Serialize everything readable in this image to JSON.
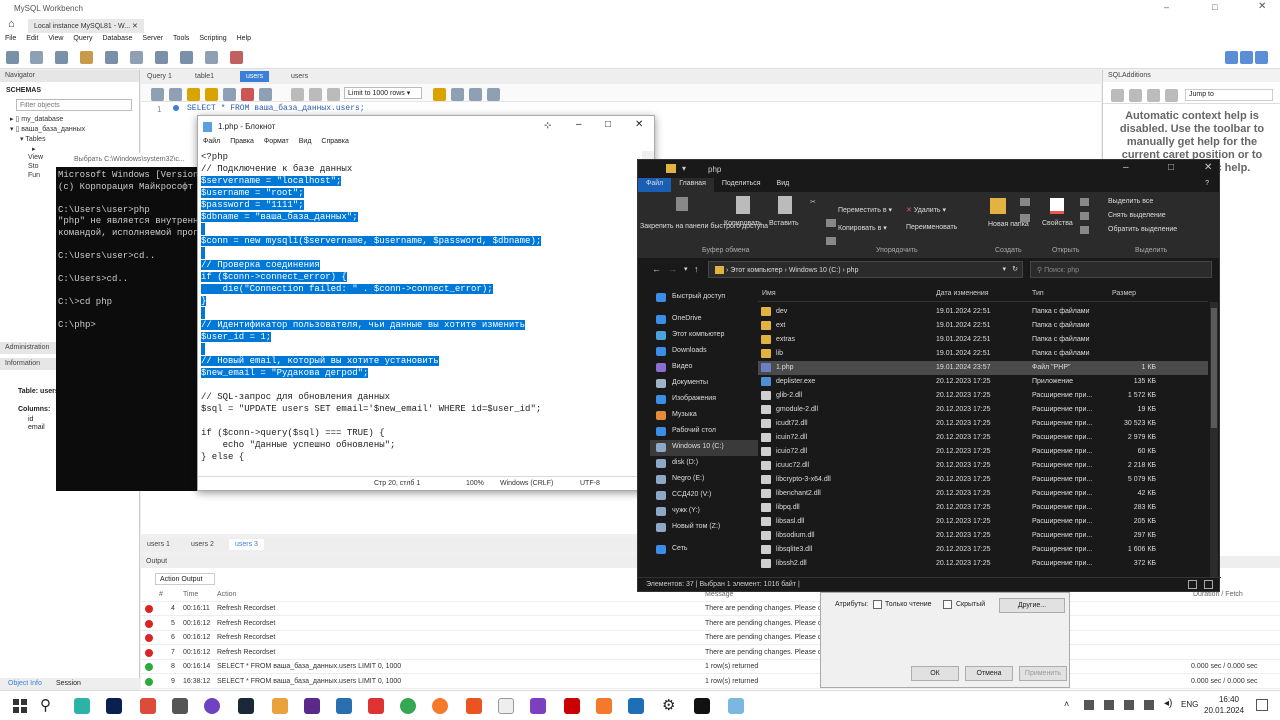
{
  "workbench": {
    "title": "MySQL Workbench",
    "home_tab": "Local instance MySQL81 - W...",
    "menu": [
      "File",
      "Edit",
      "View",
      "Query",
      "Database",
      "Server",
      "Tools",
      "Scripting",
      "Help"
    ],
    "navigator": {
      "label": "Navigator",
      "schemas": "SCHEMAS",
      "filter_placeholder": "Filter objects",
      "tree": [
        "my_database",
        "ваша_база_данных",
        "Tables",
        "View",
        "Sto",
        "Fun"
      ]
    },
    "admin_tabs": [
      "Administration",
      "Information"
    ],
    "info": {
      "table_label": "Table: users",
      "columns_label": "Columns:",
      "cols": [
        "id",
        "email"
      ]
    },
    "query_tabs": [
      "Query 1",
      "table1",
      "users",
      "users"
    ],
    "limit": "Limit to 1000 rows",
    "sql_line_no": "1",
    "sql": "SELECT * FROM ваша_база_данных.users;",
    "sqladd": {
      "title": "SQLAdditions",
      "jump": "Jump to",
      "help": "Automatic context help is disabled. Use the toolbar to manually get help for the current caret position or to toggle automatic help."
    },
    "result_tabs": [
      "users 1",
      "users 2",
      "users 3"
    ],
    "output": {
      "label": "Output",
      "mode": "Action Output",
      "headers": [
        "#",
        "Time",
        "Action",
        "Message",
        "Duration / Fetch"
      ],
      "rows": [
        {
          "n": "4",
          "time": "00:16:11",
          "action": "Refresh Recordset",
          "msg": "There are pending changes. Please c",
          "dur": "",
          "status": "err"
        },
        {
          "n": "5",
          "time": "00:16:12",
          "action": "Refresh Recordset",
          "msg": "There are pending changes. Please c",
          "dur": "",
          "status": "err"
        },
        {
          "n": "6",
          "time": "00:16:12",
          "action": "Refresh Recordset",
          "msg": "There are pending changes. Please c",
          "dur": "",
          "status": "err"
        },
        {
          "n": "7",
          "time": "00:16:12",
          "action": "Refresh Recordset",
          "msg": "There are pending changes. Please c",
          "dur": "",
          "status": "err"
        },
        {
          "n": "8",
          "time": "00:16:14",
          "action": "SELECT * FROM ваша_база_данных.users LIMIT 0, 1000",
          "msg": "1 row(s) returned",
          "dur": "0.000 sec / 0.000 sec",
          "status": "ok"
        },
        {
          "n": "9",
          "time": "16:38:12",
          "action": "SELECT * FROM ваша_база_данных.users LIMIT 0, 1000",
          "msg": "1 row(s) returned",
          "dur": "0.000 sec / 0.000 sec",
          "status": "ok"
        }
      ]
    },
    "bottom_tabs": [
      "Object Info",
      "Session"
    ]
  },
  "cmd": {
    "title": "Выбрать C:\\Windows\\system32\\c...",
    "text": "Microsoft Windows [Version\n(c) Корпорация Майкрософт\n\nC:\\Users\\user>php\n\"php\" не является внутренн\nкомандой, исполняемой прог\n\nC:\\Users\\user>cd..\n\nC:\\Users>cd..\n\nC:\\>cd php\n\nC:\\php>"
  },
  "notepad": {
    "title": "1.php - Блокнот",
    "menu": [
      "Файл",
      "Правка",
      "Формат",
      "Вид",
      "Справка"
    ],
    "lines": [
      {
        "t": "<?php",
        "h": false
      },
      {
        "t": "// Подключение к базе данных",
        "h": false
      },
      {
        "t": "$servername = \"localhost\";",
        "h": true
      },
      {
        "t": "$username = \"root\";",
        "h": true
      },
      {
        "t": "$password = \"1111\";",
        "h": true
      },
      {
        "t": "$dbname = \"ваша_база_данных\";",
        "h": true
      },
      {
        "t": "",
        "h": true
      },
      {
        "t": "$conn = new mysqli($servername, $username, $password, $dbname);",
        "h": true
      },
      {
        "t": "",
        "h": true
      },
      {
        "t": "// Проверка соединения",
        "h": true
      },
      {
        "t": "if ($conn->connect_error) {",
        "h": true
      },
      {
        "t": "    die(\"Connection failed: \" . $conn->connect_error);",
        "h": true
      },
      {
        "t": "}",
        "h": true
      },
      {
        "t": "",
        "h": true
      },
      {
        "t": "// Идентификатор пользователя, чьи данные вы хотите изменить",
        "h": true
      },
      {
        "t": "$user_id = 1;",
        "h": true
      },
      {
        "t": "",
        "h": true
      },
      {
        "t": "// Новый email, который вы хотите установить",
        "h": true
      },
      {
        "t": "$new_email = \"Рудакова дегроd\";",
        "h": true
      },
      {
        "t": "",
        "h": false
      },
      {
        "t": "// SQL-запрос для обновления данных",
        "h": false
      },
      {
        "t": "$sql = \"UPDATE users SET email='$new_email' WHERE id=$user_id\";",
        "h": false
      },
      {
        "t": "",
        "h": false
      },
      {
        "t": "if ($conn->query($sql) === TRUE) {",
        "h": false
      },
      {
        "t": "    echo \"Данные успешно обновлены\";",
        "h": false
      },
      {
        "t": "} else {",
        "h": false
      }
    ],
    "status": {
      "pos": "Стр 20, стлб 1",
      "zoom": "100%",
      "eol": "Windows (CRLF)",
      "enc": "UTF-8"
    }
  },
  "explorer": {
    "title": "php",
    "tabs": [
      "Файл",
      "Главная",
      "Поделиться",
      "Вид"
    ],
    "ribbon": {
      "pin": "Закрепить на панели быстрого доступа",
      "copy": "Копировать",
      "paste": "Вставить",
      "move": "Переместить в",
      "copy_to": "Копировать в",
      "delete": "Удалить",
      "rename": "Переименовать",
      "new_folder": "Новая папка",
      "props": "Свойства",
      "select_all": "Выделить все",
      "deselect": "Снять выделение",
      "invert": "Обратить выделение",
      "g_clipboard": "Буфер обмена",
      "g_organize": "Упорядочить",
      "g_new": "Создать",
      "g_open": "Открыть",
      "g_select": "Выделить"
    },
    "address": [
      "Этот компьютер",
      "Windows 10 (C:)",
      "php"
    ],
    "search_placeholder": "Поиск: php",
    "sidebar": [
      "Быстрый доступ",
      "OneDrive",
      "Этот компьютер",
      "Downloads",
      "Видео",
      "Документы",
      "Изображения",
      "Музыка",
      "Рабочий стол",
      "Windows 10 (C:)",
      "disk (D:)",
      "Negro (E:)",
      "ССД420 (V:)",
      "чужк (Y:)",
      "Новый том (Z:)",
      "Сеть"
    ],
    "headers": [
      "Имя",
      "Дата изменения",
      "Тип",
      "Размер"
    ],
    "files": [
      [
        "dev",
        "19.01.2024 22:51",
        "Папка с файлами",
        "",
        "folder"
      ],
      [
        "ext",
        "19.01.2024 22:51",
        "Папка с файлами",
        "",
        "folder"
      ],
      [
        "extras",
        "19.01.2024 22:51",
        "Папка с файлами",
        "",
        "folder"
      ],
      [
        "lib",
        "19.01.2024 22:51",
        "Папка с файлами",
        "",
        "folder"
      ],
      [
        "1.php",
        "19.01.2024 23:57",
        "Файл \"PHP\"",
        "1 КБ",
        "php"
      ],
      [
        "deplister.exe",
        "20.12.2023 17:25",
        "Приложение",
        "135 КБ",
        "exe"
      ],
      [
        "glib-2.dll",
        "20.12.2023 17:25",
        "Расширение при...",
        "1 572 КБ",
        "dll"
      ],
      [
        "gmodule-2.dll",
        "20.12.2023 17:25",
        "Расширение при...",
        "19 КБ",
        "dll"
      ],
      [
        "icudt72.dll",
        "20.12.2023 17:25",
        "Расширение при...",
        "30 523 КБ",
        "dll"
      ],
      [
        "icuin72.dll",
        "20.12.2023 17:25",
        "Расширение при...",
        "2 979 КБ",
        "dll"
      ],
      [
        "icuio72.dll",
        "20.12.2023 17:25",
        "Расширение при...",
        "60 КБ",
        "dll"
      ],
      [
        "icuuc72.dll",
        "20.12.2023 17:25",
        "Расширение при...",
        "2 218 КБ",
        "dll"
      ],
      [
        "libcrypto-3-x64.dll",
        "20.12.2023 17:25",
        "Расширение при...",
        "5 079 КБ",
        "dll"
      ],
      [
        "libenchant2.dll",
        "20.12.2023 17:25",
        "Расширение при...",
        "42 КБ",
        "dll"
      ],
      [
        "libpq.dll",
        "20.12.2023 17:25",
        "Расширение при...",
        "283 КБ",
        "dll"
      ],
      [
        "libsasl.dll",
        "20.12.2023 17:25",
        "Расширение при...",
        "205 КБ",
        "dll"
      ],
      [
        "libsodium.dll",
        "20.12.2023 17:25",
        "Расширение при...",
        "297 КБ",
        "dll"
      ],
      [
        "libsqlite3.dll",
        "20.12.2023 17:25",
        "Расширение при...",
        "1 606 КБ",
        "dll"
      ],
      [
        "libssh2.dll",
        "20.12.2023 17:25",
        "Расширение при...",
        "372 КБ",
        "dll"
      ]
    ],
    "status": "Элементов: 37  |  Выбран 1 элемент: 1016 байт  |"
  },
  "dialog": {
    "attrs": "Атрибуты:",
    "readonly": "Только чтение",
    "hidden": "Скрытый",
    "other": "Другие...",
    "ok": "ОК",
    "cancel": "Отмена",
    "apply": "Применить"
  },
  "taskbar": {
    "lang": "ENG",
    "time": "16:40",
    "date": "20.01.2024"
  }
}
